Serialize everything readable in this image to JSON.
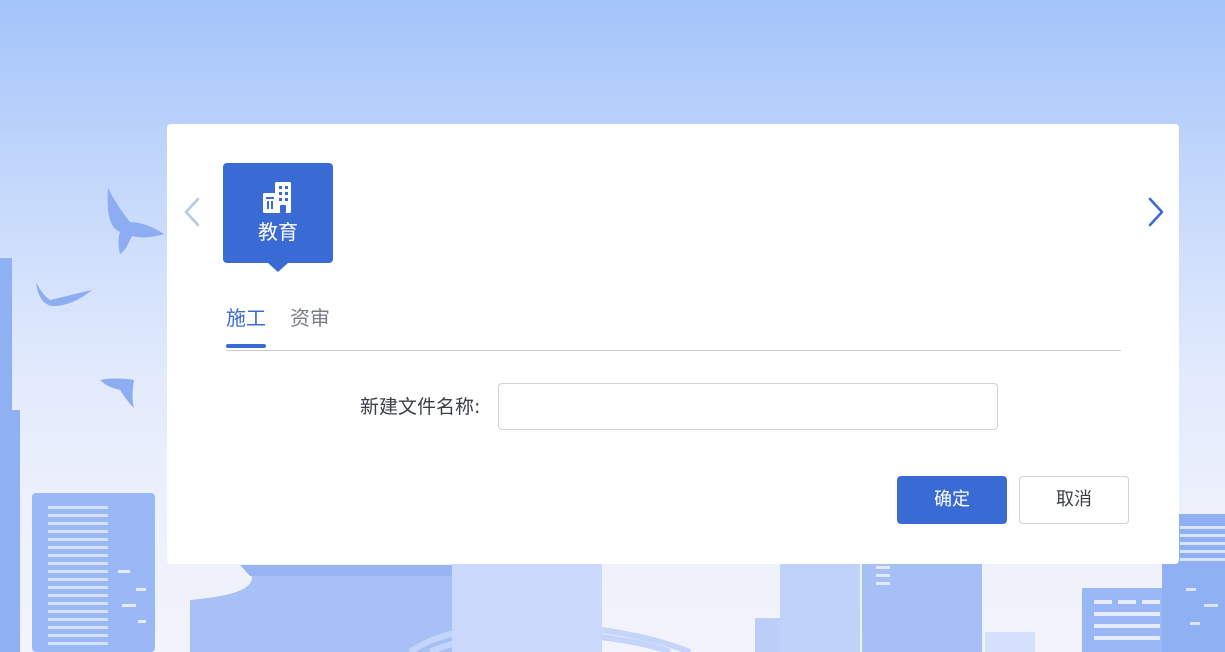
{
  "carousel": {
    "prev_icon": "chevron-left-icon",
    "next_icon": "chevron-right-icon",
    "active_category": {
      "label": "教育",
      "icon": "building-icon"
    }
  },
  "tabs": [
    {
      "label": "施工",
      "active": true
    },
    {
      "label": "资审",
      "active": false
    }
  ],
  "form": {
    "name_label": "新建文件名称:",
    "name_value": "",
    "name_placeholder": ""
  },
  "actions": {
    "confirm_label": "确定",
    "cancel_label": "取消"
  },
  "colors": {
    "accent": "#3a6bd4",
    "arrow_disabled": "#b8c8ea",
    "background_top": "#a3c4f9",
    "background_bottom": "#f2f3fb"
  }
}
